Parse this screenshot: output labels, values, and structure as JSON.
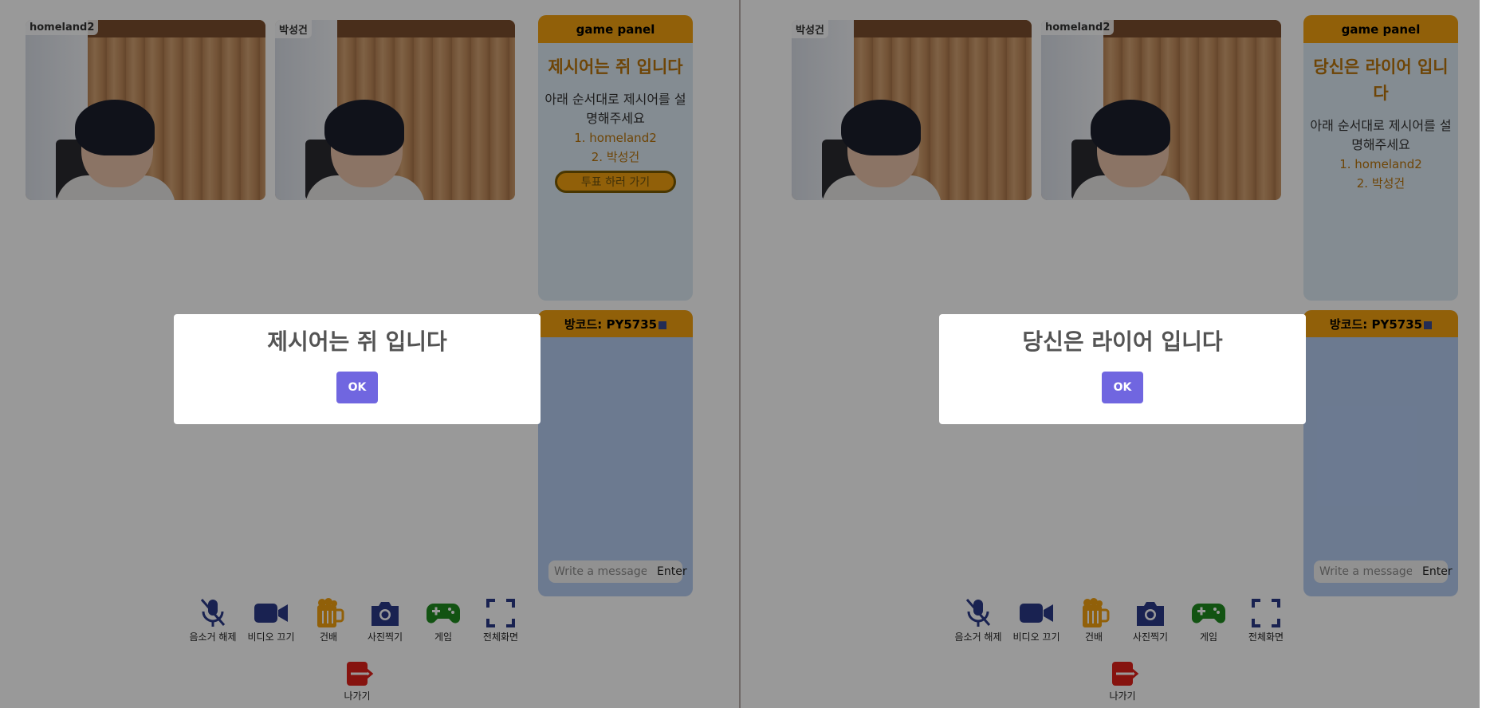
{
  "left": {
    "tiles": [
      {
        "name": "homeland2"
      },
      {
        "name": "박성건"
      }
    ],
    "game_panel": {
      "header": "game panel",
      "title": "제시어는 쥐 입니다",
      "instruction": "아래 순서대로 제시어를 설명해주세요",
      "players": [
        "1. homeland2",
        "2. 박성건"
      ],
      "vote_button": "투표 하러 가기"
    },
    "chat": {
      "room_code": "방코드: PY5735",
      "placeholder": "Write a message",
      "enter": "Enter"
    },
    "modal": {
      "title": "제시어는 쥐 입니다",
      "ok": "OK"
    }
  },
  "right": {
    "tiles": [
      {
        "name": "박성건"
      },
      {
        "name": "homeland2"
      }
    ],
    "game_panel": {
      "header": "game panel",
      "title": "당신은 라이어 입니다",
      "instruction": "아래 순서대로 제시어를 설명해주세요",
      "players": [
        "1. homeland2",
        "2. 박성건"
      ]
    },
    "chat": {
      "room_code": "방코드: PY5735",
      "placeholder": "Write a message",
      "enter": "Enter"
    },
    "modal": {
      "title": "당신은 라이어 입니다",
      "ok": "OK"
    }
  },
  "toolbar": {
    "mic": "음소거 해제",
    "video": "비디오 끄기",
    "cheers": "건배",
    "photo": "사진찍기",
    "game": "게임",
    "fullscreen": "전체화면",
    "exit": "나가기"
  },
  "colors": {
    "panel_header": "#f2a00f",
    "panel_title": "#b8730a",
    "modal_button": "#7066e0",
    "toolbar_icon": "#2b3a87",
    "game_icon": "#1f8a1f",
    "exit_icon": "#e0201a"
  },
  "icons": [
    "mic-off-icon",
    "video-camera-icon",
    "beer-mug-icon",
    "camera-icon",
    "gamepad-icon",
    "fullscreen-icon",
    "exit-icon",
    "copy-icon"
  ]
}
